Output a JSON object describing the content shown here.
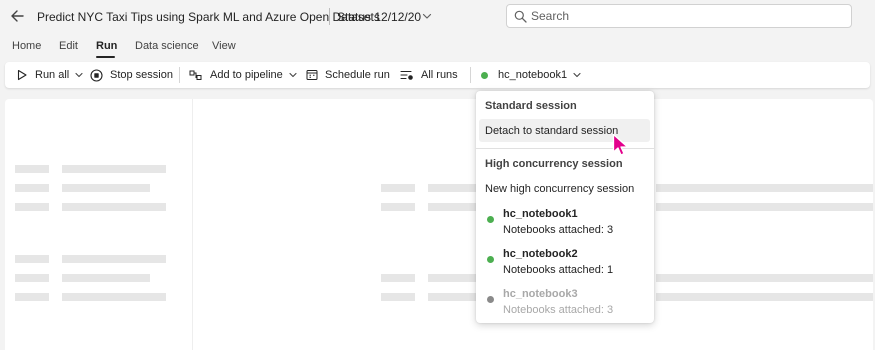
{
  "title_bar": {
    "document_title": "Predict NYC Taxi Tips using Spark ML and Azure Open Datasets",
    "status": "Status 12/12/20",
    "search_placeholder": "Search"
  },
  "menu_tabs": [
    {
      "label": "Home",
      "active": false
    },
    {
      "label": "Edit",
      "active": false
    },
    {
      "label": "Run",
      "active": true
    },
    {
      "label": "Data science",
      "active": false
    },
    {
      "label": "View",
      "active": false
    }
  ],
  "toolbar": {
    "run_all": "Run all",
    "stop_session": "Stop session",
    "add_to_pipeline": "Add to pipeline",
    "schedule_run": "Schedule run",
    "all_runs": "All runs",
    "session": "hc_notebook1"
  },
  "session_menu": {
    "standard_header": "Standard session",
    "detach": "Detach to standard session",
    "hc_header": "High concurrency session",
    "new_hc": "New high concurrency session",
    "sessions": [
      {
        "name": "hc_notebook1",
        "attached": "Notebooks attached: 3",
        "status": "active"
      },
      {
        "name": "hc_notebook2",
        "attached": "Notebooks attached: 1",
        "status": "active"
      },
      {
        "name": "hc_notebook3",
        "attached": "Notebooks attached: 3",
        "status": "inactive"
      }
    ]
  },
  "colors": {
    "active_dot": "#4caf50",
    "inactive_dot": "#8a8a8a",
    "cursor": "#e3008c",
    "tab_underline": "#242424"
  },
  "icons": {
    "back": "arrow-left-icon",
    "search": "search-icon",
    "run_all": "play-icon",
    "stop": "stop-icon",
    "pipeline": "pipeline-icon",
    "schedule": "calendar-icon",
    "all_runs": "list-icon",
    "chevron": "chevron-down-icon"
  }
}
